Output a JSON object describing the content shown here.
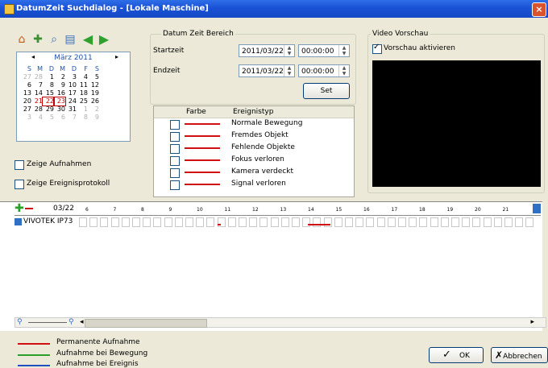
{
  "window": {
    "title": "DatumZeit Suchdialog - [Lokale Maschine]",
    "close_glyph": "×"
  },
  "toolbar": {
    "icons": [
      "home-icon",
      "add-icon",
      "zoom-icon",
      "filter-icon",
      "back-icon",
      "forward-icon"
    ]
  },
  "calendar": {
    "month_label": "März 2011",
    "prev": "◂",
    "next": "▸",
    "weekdays": [
      "S",
      "M",
      "D",
      "M",
      "D",
      "F",
      "S"
    ],
    "weeks": [
      [
        "27",
        "28",
        "1",
        "2",
        "3",
        "4",
        "5"
      ],
      [
        "6",
        "7",
        "8",
        "9",
        "10",
        "11",
        "12"
      ],
      [
        "13",
        "14",
        "15",
        "16",
        "17",
        "18",
        "19"
      ],
      [
        "20",
        "21",
        "22",
        "23",
        "24",
        "25",
        "26"
      ],
      [
        "27",
        "28",
        "29",
        "30",
        "31",
        "1",
        "2"
      ],
      [
        "3",
        "4",
        "5",
        "6",
        "7",
        "8",
        "9"
      ]
    ]
  },
  "date_range": {
    "group_label": "Datum Zeit Bereich",
    "start_label": "Startzeit",
    "end_label": "Endzeit",
    "start_date": "2011/03/22",
    "start_time": "00:00:00",
    "end_date": "2011/03/22",
    "end_time": "00:00:00",
    "set_button": "Set"
  },
  "events": {
    "col_color": "Farbe",
    "col_type": "Ereignistyp",
    "rows": [
      "Normale Bewegung",
      "Fremdes Objekt",
      "Fehlende Objekte",
      "Fokus verloren",
      "Kamera verdeckt",
      "Signal verloren"
    ]
  },
  "options": {
    "show_recordings": "Zeige Aufnahmen",
    "show_event_log": "Zeige Ereignisprotokoll"
  },
  "video": {
    "group_label": "Video Vorschau",
    "enable_preview": "Vorschau aktivieren"
  },
  "timeline": {
    "date_label": "03/22",
    "camera": "VIVOTEK IP73",
    "hours": [
      "6",
      "7",
      "8",
      "9",
      "10",
      "11",
      "12",
      "13",
      "14",
      "15",
      "16",
      "17",
      "18",
      "19",
      "20",
      "21"
    ]
  },
  "legend": [
    "Permanente Aufnahme",
    "Aufnahme bei Bewegung",
    "Aufnahme bei Ereignis"
  ],
  "buttons": {
    "ok": "OK",
    "cancel": "Abbrechen"
  },
  "colors": {
    "event_red": "#d01010",
    "permanent": "#d01010",
    "motion": "#2aa02a",
    "event": "#1f4fc0"
  }
}
